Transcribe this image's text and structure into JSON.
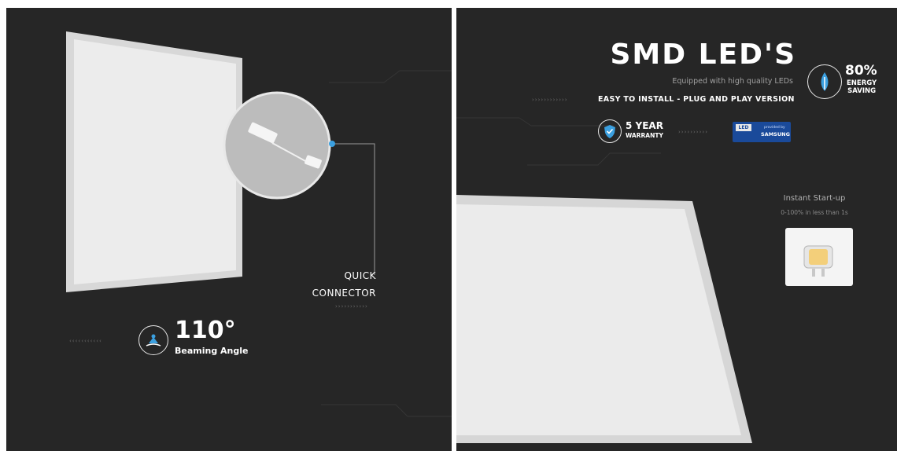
{
  "left_panel": {
    "connector": {
      "line1": "QUICK",
      "line2": "CONNECTOR",
      "dots": "›››››››››››"
    },
    "beam": {
      "dots": "‹‹‹‹‹‹‹‹‹‹‹",
      "angle": "110°",
      "label": "Beaming Angle",
      "icon": "lamp-beam-icon"
    }
  },
  "right_panel": {
    "heading": "SMD LED'S",
    "subheading": "Equipped with high quality LEDs",
    "energy": {
      "percent": "80%",
      "line1": "ENERGY",
      "line2": "SAVING",
      "icon": "leaf-drop-icon"
    },
    "install": {
      "dots": "››››››››››››",
      "text": "EASY TO INSTALL - PLUG AND PLAY VERSION"
    },
    "warranty": {
      "line1": "5 YEAR",
      "line2": "WARRANTY",
      "icon": "shield-check-icon",
      "dots": "››››››››››"
    },
    "samsung": {
      "small": "provided by",
      "brand": "SAMSUNG",
      "led": "LED"
    },
    "instant": {
      "title": "Instant Start-up",
      "subtitle": "0-100% in less than 1s"
    }
  },
  "colors": {
    "background": "#262626",
    "accent": "#3ba0e0",
    "panel_white": "#e4e4e4",
    "chip_yellow": "#f3cf7a",
    "samsung_blue": "#1a4a9a"
  }
}
